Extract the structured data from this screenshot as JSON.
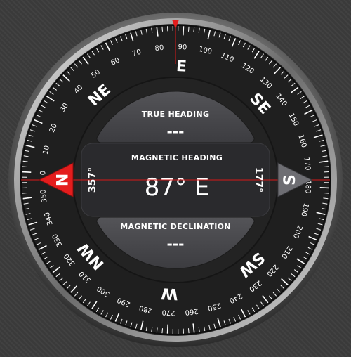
{
  "app": {
    "name": "Compass"
  },
  "heading": {
    "value": "87° E"
  },
  "true_heading": {
    "label": "TRUE HEADING",
    "value": "---"
  },
  "magnetic_heading": {
    "label": "MAGNETIC HEADING",
    "value": "87° E"
  },
  "magnetic_declination": {
    "label": "MAGNETIC DECLINATION",
    "value": "---"
  },
  "side_labels": {
    "left": "357°",
    "right": "177°"
  },
  "cardinals": [
    "E",
    "SE",
    "S",
    "SW",
    "W",
    "NW",
    "N",
    "NE"
  ],
  "dial_rotation_deg": -87,
  "tick_labels": [
    0,
    10,
    20,
    30,
    40,
    50,
    60,
    70,
    80,
    90,
    100,
    110,
    120,
    130,
    140,
    150,
    160,
    170,
    180,
    190,
    200,
    210,
    220,
    230,
    240,
    250,
    260,
    270,
    280,
    290,
    300,
    310,
    320,
    330,
    340,
    350
  ],
  "icons": {
    "north_pointer": "north-pointer-icon",
    "south_pointer": "south-pointer-icon",
    "top_marker": "lubber-line-marker-icon"
  },
  "colors": {
    "north_pointer": "#e41d1d",
    "south_pointer": "#6e6e73",
    "marker": "#e41d1d",
    "text": "#ffffff"
  }
}
